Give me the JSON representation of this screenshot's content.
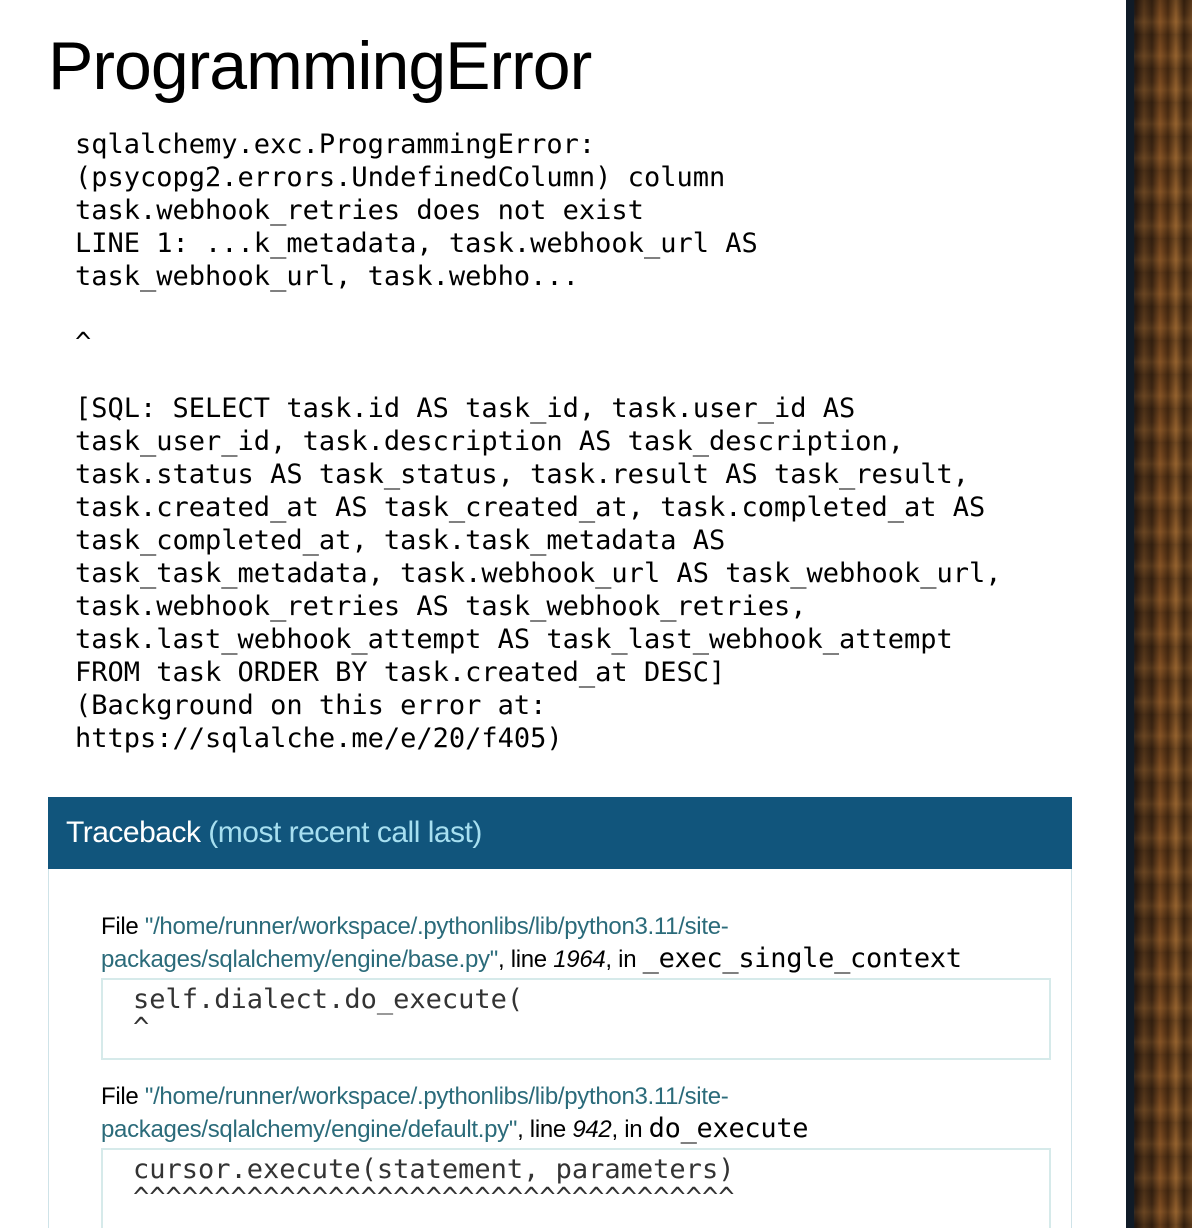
{
  "page": {
    "title": "ProgrammingError",
    "error_message": "sqlalchemy.exc.ProgrammingError:\n(psycopg2.errors.UndefinedColumn) column\ntask.webhook_retries does not exist\nLINE 1: ...k_metadata, task.webhook_url AS\ntask_webhook_url, task.webho...\n\n^\n\n[SQL: SELECT task.id AS task_id, task.user_id AS\ntask_user_id, task.description AS task_description,\ntask.status AS task_status, task.result AS task_result,\ntask.created_at AS task_created_at, task.completed_at AS\ntask_completed_at, task.task_metadata AS\ntask_task_metadata, task.webhook_url AS task_webhook_url,\ntask.webhook_retries AS task_webhook_retries,\ntask.last_webhook_attempt AS task_last_webhook_attempt\nFROM task ORDER BY task.created_at DESC]\n(Background on this error at:\nhttps://sqlalche.me/e/20/f405)"
  },
  "traceback": {
    "title": "Traceback",
    "subtitle": "(most recent call last)",
    "frames": [
      {
        "file_prefix": "File ",
        "filename": "\"/home/runner/workspace/.pythonlibs/lib/python3.11/site-packages/sqlalchemy/engine/base.py\"",
        "line_label": ", line ",
        "lineno": "1964",
        "in_label": ", in ",
        "function": "_exec_single_context",
        "code": "self.dialect.do_execute(\n^"
      },
      {
        "file_prefix": "File ",
        "filename": "\"/home/runner/workspace/.pythonlibs/lib/python3.11/site-packages/sqlalchemy/engine/default.py\"",
        "line_label": ", line ",
        "lineno": "942",
        "in_label": ", in ",
        "function": "do_execute",
        "code": "cursor.execute(statement, parameters)\n^^^^^^^^^^^^^^^^^^^^^^^^^^^^^^^^^^^^^"
      }
    ]
  },
  "colors": {
    "traceback_header_bg": "#11557c",
    "traceback_subtitle": "#a7dff0",
    "filename_link": "#2b6b7a"
  }
}
